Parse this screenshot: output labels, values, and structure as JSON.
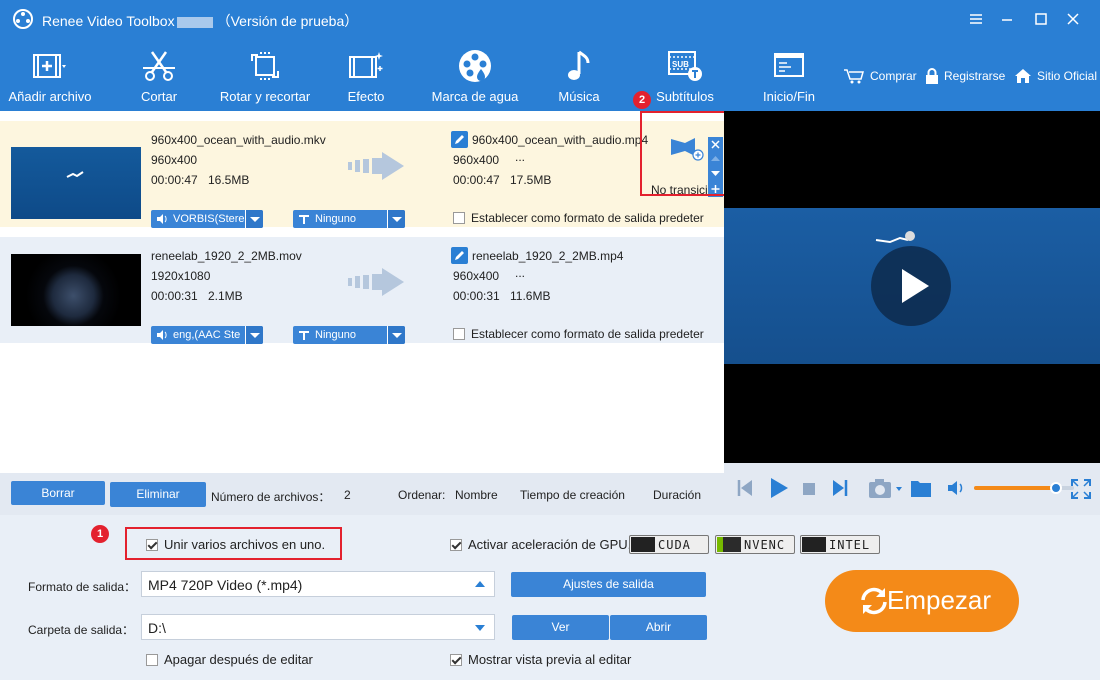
{
  "window": {
    "app_name": "Renee Video Toolbox",
    "title_suffix": "（Versión de prueba）"
  },
  "toolbar": {
    "items": [
      {
        "label": "Añadir archivo",
        "icon": "add-file-icon"
      },
      {
        "label": "Cortar",
        "icon": "scissors-icon"
      },
      {
        "label": "Rotar y recortar",
        "icon": "crop-rotate-icon"
      },
      {
        "label": "Efecto",
        "icon": "effect-icon"
      },
      {
        "label": "Marca de agua",
        "icon": "watermark-icon"
      },
      {
        "label": "Música",
        "icon": "music-note-icon"
      },
      {
        "label": "Subtítulos",
        "icon": "subtitle-icon"
      },
      {
        "label": "Inicio/Fin",
        "icon": "start-end-icon"
      }
    ],
    "links": {
      "buy": "Comprar",
      "register": "Registrarse",
      "site": "Sitio Oficial"
    }
  },
  "files": [
    {
      "src_name": "960x400_ocean_with_audio.mkv",
      "src_res": "960x400",
      "src_dur": "00:00:47",
      "src_size": "16.5MB",
      "out_name": "960x400_ocean_with_audio.mp4",
      "out_res": "960x400",
      "out_more": "...",
      "out_dur": "00:00:47",
      "out_size": "17.5MB",
      "audio": "VORBIS(Stere",
      "subtitle": "Ninguno",
      "transition": "No transicio",
      "default_label": "Establecer como formato de salida predeter"
    },
    {
      "src_name": "reneelab_1920_2_2MB.mov",
      "src_res": "1920x1080",
      "src_dur": "00:00:31",
      "src_size": "2.1MB",
      "out_name": "reneelab_1920_2_2MB.mp4",
      "out_res": "960x400",
      "out_more": "...",
      "out_dur": "00:00:31",
      "out_size": "11.6MB",
      "audio": "eng,(AAC Ste",
      "subtitle": "Ninguno",
      "default_label": "Establecer como formato de salida predeter"
    }
  ],
  "badges": {
    "one": "1",
    "two": "2"
  },
  "listbar": {
    "clear": "Borrar",
    "delete": "Eliminar",
    "count_label": "Número de archivos：",
    "count": "2",
    "sort_label": "Ordenar:",
    "sort_name": "Nombre",
    "sort_created": "Tiempo de creación",
    "sort_duration": "Duración"
  },
  "preview": {
    "volume_level": 0.82
  },
  "bottom": {
    "merge_label": "Unir varios archivos en uno.",
    "merge_checked": true,
    "gpu_label": "Activar aceleración de GPU.",
    "gpu_checked": true,
    "gpu_options": [
      "CUDA",
      "NVENC",
      "INTEL"
    ],
    "format_label": "Formato de salida：",
    "format_value": "MP4 720P Video (*.mp4)",
    "settings_button": "Ajustes de salida",
    "folder_label": "Carpeta de salida：",
    "folder_value": "D:\\",
    "view_button": "Ver",
    "open_button": "Abrir",
    "shutdown_label": "Apagar después de editar",
    "shutdown_checked": false,
    "preview_label": "Mostrar vista previa al editar",
    "preview_checked": true,
    "start_button": "Empezar"
  },
  "colors": {
    "primary": "#2a7fd4",
    "start": "#f48a18",
    "highlight": "#e3212e"
  }
}
